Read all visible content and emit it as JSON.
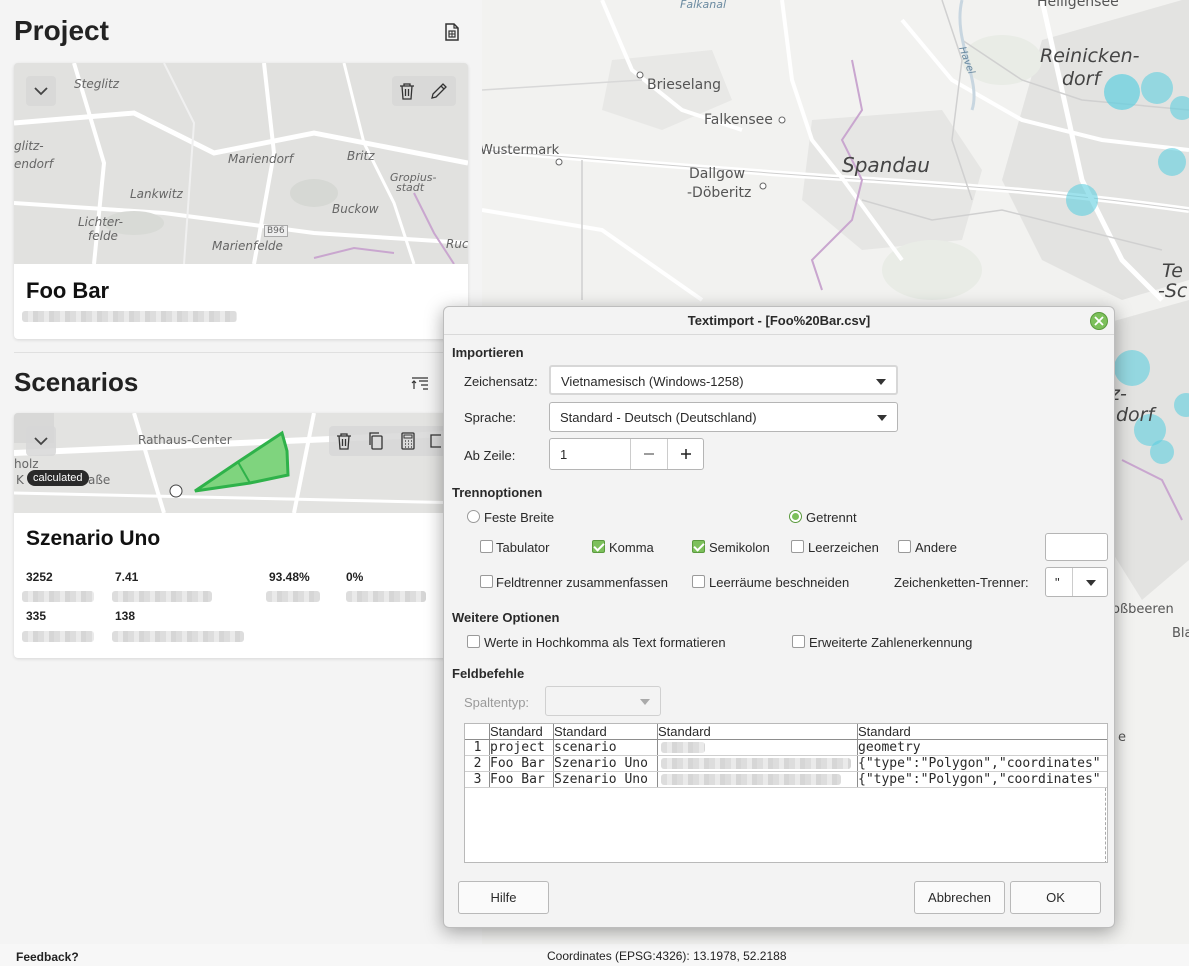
{
  "project": {
    "heading": "Project",
    "card": {
      "name": "Foo Bar",
      "map_labels": [
        "Steglitz",
        "glitz-",
        "endorf",
        "Mariendorf",
        "Britz",
        "Gropius-",
        "stadt",
        "Lankwitz",
        "Buckow",
        "Lichter-",
        "felde",
        "Marienfelde",
        "B96",
        "Ruc"
      ]
    }
  },
  "scenarios": {
    "heading": "Scenarios",
    "card": {
      "name": "Szenario Uno",
      "badge": "calculated",
      "map_labels": [
        "Rathaus-Center",
        "holz",
        "K",
        "aße"
      ],
      "stats_row1": [
        "3252",
        "7.41",
        "93.48%",
        "0%"
      ],
      "stats_row2": [
        "335",
        "138"
      ]
    }
  },
  "statusbar": {
    "feedback": "Feedback?",
    "coordinates": "Coordinates (EPSG:4326): 13.1978, 52.2188"
  },
  "map": {
    "labels": [
      "Brieselang",
      "Falkensee",
      "Wustermark",
      "Spandau",
      "Dallgow",
      "-Döberitz",
      "Reinicken-",
      "dorf",
      "Te",
      "-Sc",
      "z-",
      "dorf",
      "oßbeeren",
      "Bla",
      "Havel",
      "Falkanal",
      "Heiligensee",
      "e"
    ]
  },
  "dialog": {
    "title": "Textimport - [Foo%20Bar.csv]",
    "import_heading": "Importieren",
    "charset_label": "Zeichensatz:",
    "charset_value": "Vietnamesisch (Windows-1258)",
    "language_label": "Sprache:",
    "language_value": "Standard - Deutsch (Deutschland)",
    "from_row_label": "Ab Zeile:",
    "from_row_value": "1",
    "sep_heading": "Trennoptionen",
    "fixed_width": "Feste Breite",
    "separated": "Getrennt",
    "tab": "Tabulator",
    "comma": "Komma",
    "semicolon": "Semikolon",
    "space": "Leerzeichen",
    "other": "Andere",
    "merge": "Feldtrenner zusammenfassen",
    "trim": "Leerräume beschneiden",
    "string_delim_label": "Zeichenketten-Trenner:",
    "string_delim_value": "\"",
    "more_heading": "Weitere Optionen",
    "quoted_as_text": "Werte in Hochkomma als Text formatieren",
    "detect_numbers": "Erweiterte Zahlenerkennung",
    "field_heading": "Feldbefehle",
    "column_type_label": "Spaltentyp:",
    "grid": {
      "headers": [
        "Standard",
        "Standard",
        "Standard",
        "Standard"
      ],
      "row_numbers": [
        "1",
        "2",
        "3"
      ],
      "rows": [
        [
          "project",
          "scenario",
          "",
          "geometry"
        ],
        [
          "Foo Bar",
          "Szenario Uno",
          "",
          "{\"type\":\"Polygon\",\"coordinates\""
        ],
        [
          "Foo Bar",
          "Szenario Uno",
          "",
          "{\"type\":\"Polygon\",\"coordinates\""
        ]
      ]
    },
    "help": "Hilfe",
    "cancel": "Abbrechen",
    "ok": "OK"
  }
}
